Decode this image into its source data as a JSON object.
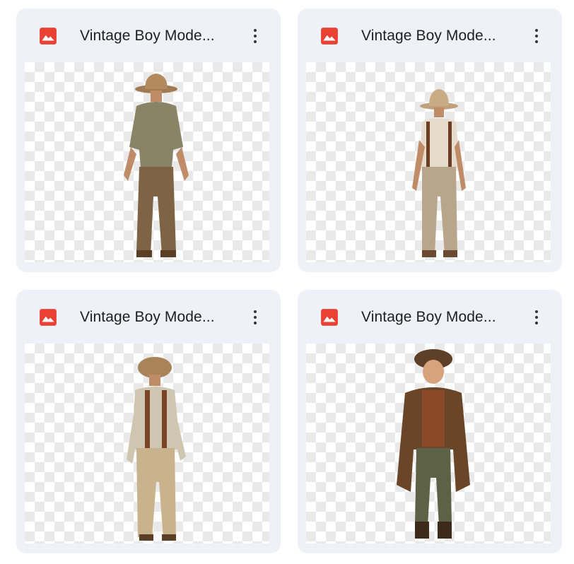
{
  "files": [
    {
      "title": "Vintage Boy Mode...",
      "icon": "image-file-icon",
      "preview": "boy-back-fedora-muddy"
    },
    {
      "title": "Vintage Boy Mode...",
      "icon": "image-file-icon",
      "preview": "boy-back-suspenders-white-shirt"
    },
    {
      "title": "Vintage Boy Mode...",
      "icon": "image-file-icon",
      "preview": "boy-back-flat-cap-suspenders"
    },
    {
      "title": "Vintage Boy Mode...",
      "icon": "image-file-icon",
      "preview": "boy-front-newsboy-coat"
    }
  ],
  "colors": {
    "card_bg": "#eef1f7",
    "icon_red": "#e94235",
    "title": "#1f1f1f"
  }
}
